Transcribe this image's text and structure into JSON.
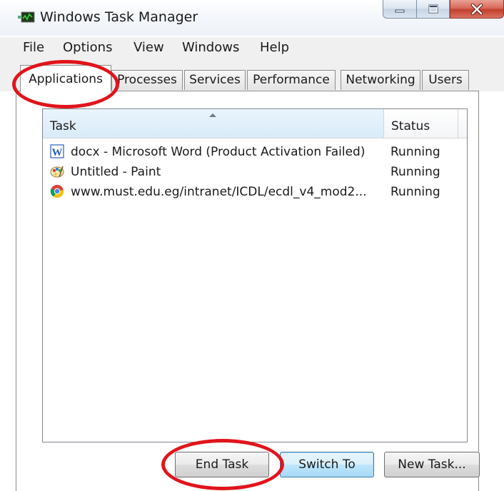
{
  "window": {
    "title": "Windows Task Manager",
    "controls": {
      "minimize": "minimize-icon",
      "maximize": "maximize-icon",
      "close": "close-icon"
    }
  },
  "menu": [
    "File",
    "Options",
    "View",
    "Windows",
    "Help"
  ],
  "tabs": [
    "Applications",
    "Processes",
    "Services",
    "Performance",
    "Networking",
    "Users"
  ],
  "active_tab": "Applications",
  "list": {
    "columns": {
      "task": "Task",
      "status": "Status"
    },
    "sorted_column": "task",
    "rows": [
      {
        "icon": "word-icon",
        "task": "docx - Microsoft Word (Product Activation Failed)",
        "status": "Running"
      },
      {
        "icon": "paint-icon",
        "task": "Untitled - Paint",
        "status": "Running"
      },
      {
        "icon": "chrome-icon",
        "task": "www.must.edu.eg/intranet/ICDL/ecdl_v4_mod2...",
        "status": "Running"
      }
    ]
  },
  "buttons": {
    "end_task": "End Task",
    "switch_to": "Switch To",
    "new_task": "New Task..."
  },
  "colors": {
    "annotation": "#e1141b",
    "close_button": "#c2402f",
    "header_highlight": "#d9ebf9"
  }
}
